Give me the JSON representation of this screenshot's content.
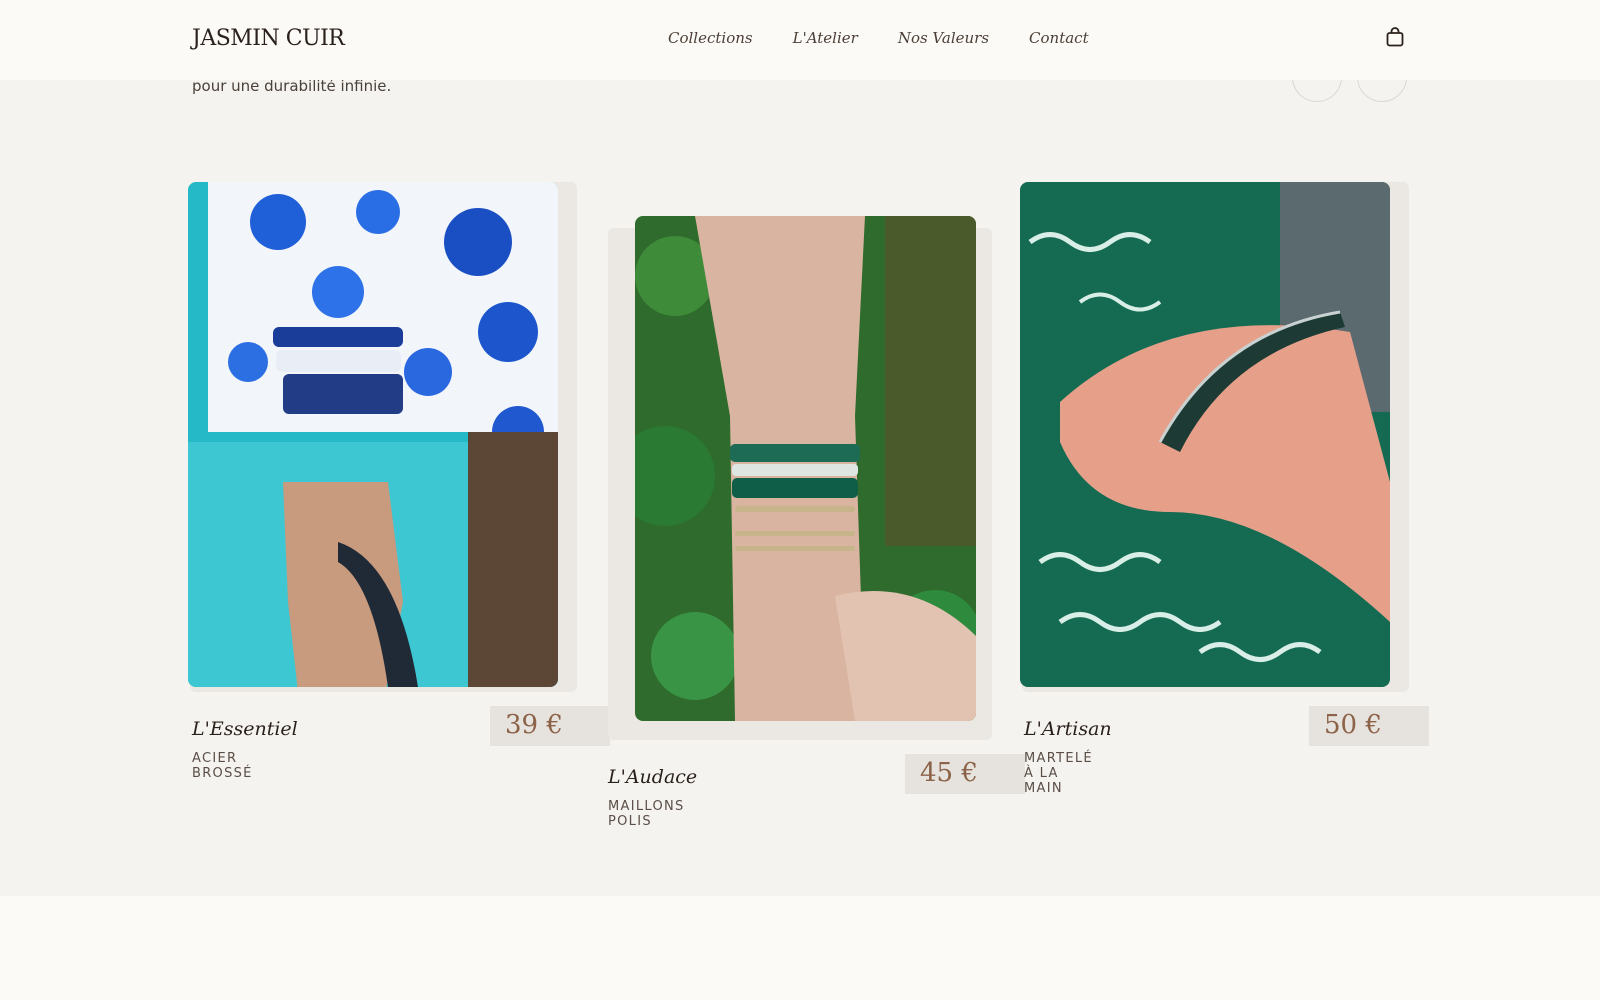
{
  "header": {
    "brand": "JASMIN CUIR",
    "nav": [
      "Collections",
      "L'Atelier",
      "Nos Valeurs",
      "Contact"
    ],
    "cart_icon": "shopping-bag-icon"
  },
  "intro": {
    "text": "pour une durabilité infinie."
  },
  "slider": {
    "prev_icon": "arrow-left-icon",
    "next_icon": "arrow-right-icon"
  },
  "products": [
    {
      "name": "L'Essentiel",
      "material": "ACIER BROSSÉ",
      "price": "39 €"
    },
    {
      "name": "L'Audace",
      "material": "MAILLONS POLIS",
      "price": "45 €"
    },
    {
      "name": "L'Artisan",
      "material": "MARTELÉ À LA MAIN",
      "price": "50 €"
    }
  ],
  "colors": {
    "background": "#f5f3ef",
    "header": "#fcfaf6",
    "price_bg": "#e6e2de",
    "price_text": "#8c6348"
  }
}
